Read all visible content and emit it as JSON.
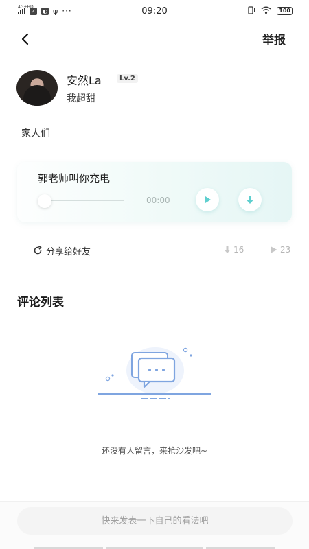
{
  "status_bar": {
    "network": "4G+HD",
    "time": "09:20",
    "battery": "100",
    "more": "···"
  },
  "header": {
    "report_label": "举报"
  },
  "profile": {
    "name": "安然La",
    "level": "Lv.2",
    "bio": "我超甜"
  },
  "post": {
    "text": "家人们"
  },
  "audio": {
    "title": "郭老师叫你充电",
    "time": "00:00",
    "progress": 0
  },
  "share": {
    "label": "分享给好友",
    "downloads": "16",
    "plays": "23"
  },
  "comments": {
    "title": "评论列表",
    "empty_text": "还没有人留言，来抢沙发吧~"
  },
  "input": {
    "placeholder": "快来发表一下自己的看法吧"
  },
  "colors": {
    "accent": "#5fcfcf",
    "illustration": "#7fa5e0"
  }
}
